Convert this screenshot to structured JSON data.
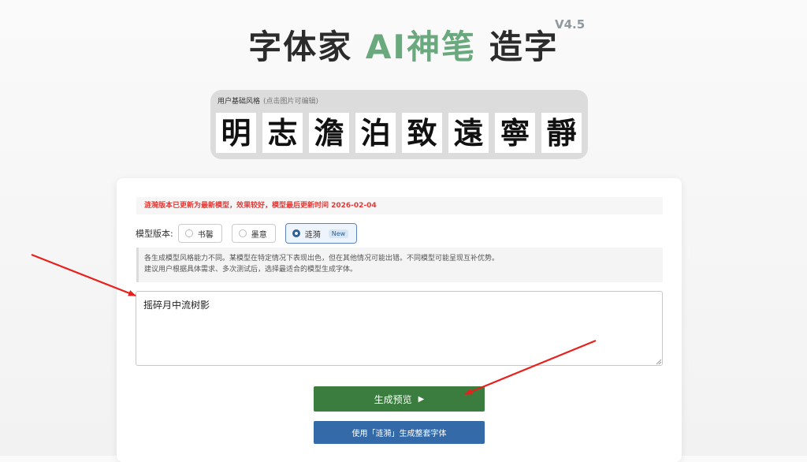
{
  "header": {
    "title_prefix": "字体家",
    "title_accent": "AI神笔",
    "title_suffix": "造字",
    "version": "V4.5"
  },
  "base_style": {
    "label": "用户基础风格",
    "hint": "(点击图片可编辑)",
    "glyphs": [
      "明",
      "志",
      "澹",
      "泊",
      "致",
      "遠",
      "寧",
      "靜"
    ]
  },
  "panel": {
    "notice": "涟漪版本已更新为最新模型，效果较好，模型最后更新时间 2026-02-04",
    "model_label": "模型版本:",
    "models": [
      {
        "label": "书馨",
        "selected": false
      },
      {
        "label": "墨意",
        "selected": false
      },
      {
        "label": "涟漪",
        "selected": true,
        "badge": "New"
      }
    ],
    "info_line1": "各生成模型风格能力不同。某模型在特定情况下表现出色，但在其他情况可能出错。不同模型可能呈现互补优势。",
    "info_line2": "建议用户根据具体需求、多次测试后，选择最适合的模型生成字体。",
    "input_value": "摇碎月中流树影",
    "preview_button": "生成预览",
    "preview_icon": "play-icon",
    "full_button": "使用「涟漪」生成整套字体"
  },
  "colors": {
    "accent_green": "#6aa97d",
    "preview_button": "#3b7d3e",
    "full_button": "#356aa8",
    "notice_red": "#e53935",
    "annotation_arrow": "#e8201c"
  }
}
